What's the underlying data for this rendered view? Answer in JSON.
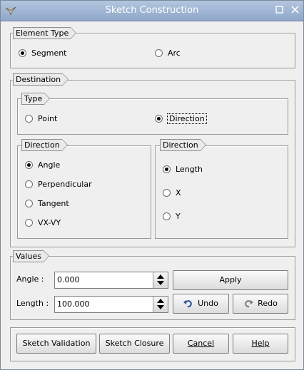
{
  "window": {
    "title": "Sketch Construction"
  },
  "element_type": {
    "legend": "Element Type",
    "options": [
      {
        "label": "Segment",
        "checked": true
      },
      {
        "label": "Arc",
        "checked": false
      }
    ]
  },
  "destination": {
    "legend": "Destination",
    "type": {
      "legend": "Type",
      "options": [
        {
          "label": "Point",
          "checked": false
        },
        {
          "label": "Direction",
          "checked": true
        }
      ]
    },
    "direction_left": {
      "legend": "Direction",
      "options": [
        {
          "label": "Angle",
          "checked": true
        },
        {
          "label": "Perpendicular",
          "checked": false
        },
        {
          "label": "Tangent",
          "checked": false
        },
        {
          "label": "VX-VY",
          "checked": false
        }
      ]
    },
    "direction_right": {
      "legend": "Direction",
      "options": [
        {
          "label": "Length",
          "checked": true
        },
        {
          "label": "X",
          "checked": false
        },
        {
          "label": "Y",
          "checked": false
        }
      ]
    }
  },
  "values": {
    "legend": "Values",
    "angle": {
      "label": "Angle :",
      "value": "0.000"
    },
    "length": {
      "label": "Length :",
      "value": "100.000"
    },
    "apply": "Apply",
    "undo": "Undo",
    "redo": "Redo"
  },
  "footer": {
    "validation": "Sketch Validation",
    "closure": "Sketch Closure",
    "cancel": "Cancel",
    "help": "Help"
  },
  "icons": {
    "app": "salome-app-icon",
    "maximize": "maximize-icon",
    "close": "close-icon",
    "undo": "undo-icon",
    "redo": "redo-icon"
  }
}
